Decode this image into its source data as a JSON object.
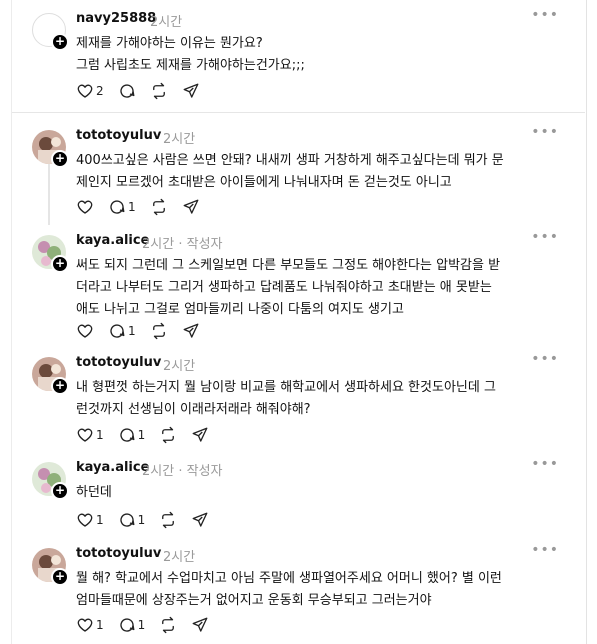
{
  "posts": [
    {
      "username": "navy25888",
      "time": "2시간",
      "author_tag": "",
      "lines": [
        "제재를 가해야하는 이유는 뭔가요?",
        "그럼 사립초도 제재를 가해야하는건가요;;;"
      ],
      "likes": "2",
      "replies": ""
    },
    {
      "username": "tototoyuluv",
      "time": "2시간",
      "author_tag": "",
      "lines": [
        "400쓰고싶은 사람은 쓰면 안돼? 내새끼 생파 거창하게 해주고싶다는데 뭐가 문",
        "제인지 모르겠어 초대받은 아이들에게 나눠내자며 돈 걷는것도 아니고"
      ],
      "likes": "",
      "replies": "1"
    },
    {
      "username": "kaya.alice",
      "time": "2시간",
      "author_tag": "· 작성자",
      "lines": [
        "써도 되지 그런데 그 스케일보면 다른 부모들도 그정도 해야한다는 압박감을 받",
        "더라고 나부터도 그리거 생파하고 답례품도 나눠줘야하고 초대받는 애 못받는",
        "애도 나뉘고 그걸로 엄마들끼리 나중이 다툼의 여지도 생기고"
      ],
      "likes": "",
      "replies": "1"
    },
    {
      "username": "tototoyuluv",
      "time": "2시간",
      "author_tag": "",
      "lines": [
        "내 형편껏 하는거지 뭘 남이랑 비교를 해학교에서 생파하세요 한것도아닌데 그",
        "런것까지 선생님이 이래라저래라 해줘야해?"
      ],
      "likes": "1",
      "replies": "1"
    },
    {
      "username": "kaya.alice",
      "time": "2시간",
      "author_tag": "· 작성자",
      "lines": [
        "하던데"
      ],
      "likes": "1",
      "replies": "1"
    },
    {
      "username": "tototoyuluv",
      "time": "2시간",
      "author_tag": "",
      "lines": [
        "뭘 해? 학교에서 수업마치고 아님 주말에 생파열어주세요 어머니 했어? 별 이런",
        "엄마들때문에 상장주는거 없어지고 운동회 무승부되고 그러는거야"
      ],
      "likes": "1",
      "replies": "1"
    }
  ],
  "icons": {
    "like": "heart-icon",
    "reply": "comment-icon",
    "repost": "repost-icon",
    "share": "share-icon",
    "more": "more-icon",
    "follow": "plus-icon"
  }
}
